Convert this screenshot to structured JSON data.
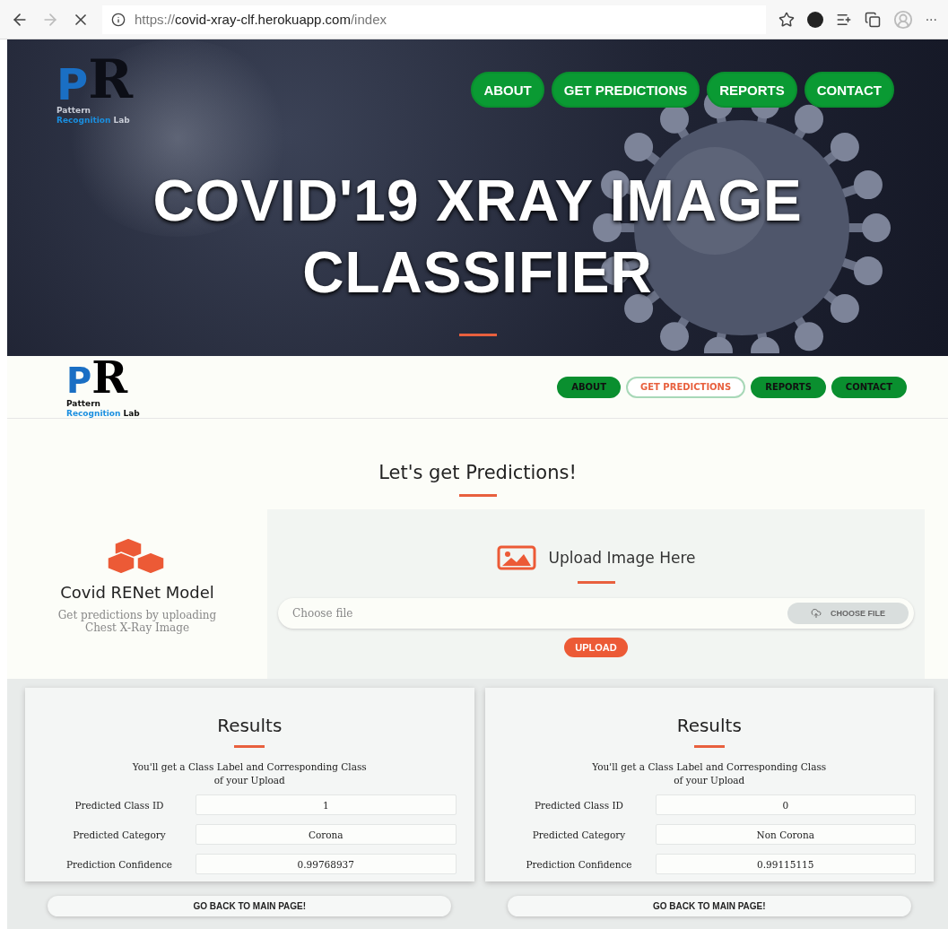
{
  "browser": {
    "url_scheme": "https://",
    "url_host": "covid-xray-clf.herokuapp.com",
    "url_path": "/index",
    "more": "···"
  },
  "hero": {
    "logo": {
      "letter_front": "P",
      "letter_back": "R",
      "line1": "Pattern",
      "line2": "Recognition",
      "line3": "Lab"
    },
    "nav": [
      {
        "label": "ABOUT",
        "selected": false
      },
      {
        "label": "GET PREDICTIONS",
        "selected": false
      },
      {
        "label": "REPORTS",
        "selected": false
      },
      {
        "label": "CONTACT",
        "selected": false
      }
    ],
    "title_lines": [
      "COVID'19 XRAY IMAGE",
      "CLASSIFIER"
    ]
  },
  "navbar": {
    "logo": {
      "letter_front": "P",
      "letter_back": "R",
      "line1": "Pattern",
      "line2": "Recognition",
      "line3": "Lab"
    },
    "nav": [
      {
        "label": "ABOUT",
        "selected": false
      },
      {
        "label": "GET PREDICTIONS",
        "selected": true
      },
      {
        "label": "REPORTS",
        "selected": false
      },
      {
        "label": "CONTACT",
        "selected": false
      }
    ]
  },
  "predictions": {
    "heading": "Let's get Predictions!",
    "model_title": "Covid RENet Model",
    "model_desc": "Get predictions by uploading Chest X-Ray Image",
    "upload_title": "Upload Image Here",
    "file_placeholder": "Choose file",
    "choose_button": "CHOOSE FILE",
    "upload_button": "UPLOAD"
  },
  "results": [
    {
      "heading": "Results",
      "desc": "You'll get a Class Label and Corresponding Class of your Upload",
      "rows": [
        {
          "label": "Predicted Class ID",
          "value": "1"
        },
        {
          "label": "Predicted Category",
          "value": "Corona"
        },
        {
          "label": "Prediction Confidence",
          "value": "0.99768937"
        }
      ],
      "back_button": "GO BACK TO MAIN PAGE!"
    },
    {
      "heading": "Results",
      "desc": "You'll get a Class Label and Corresponding Class of your Upload",
      "rows": [
        {
          "label": "Predicted Class ID",
          "value": "0"
        },
        {
          "label": "Predicted Category",
          "value": "Non Corona"
        },
        {
          "label": "Prediction Confidence",
          "value": "0.99115115"
        }
      ],
      "back_button": "GO BACK TO MAIN PAGE!"
    }
  ]
}
